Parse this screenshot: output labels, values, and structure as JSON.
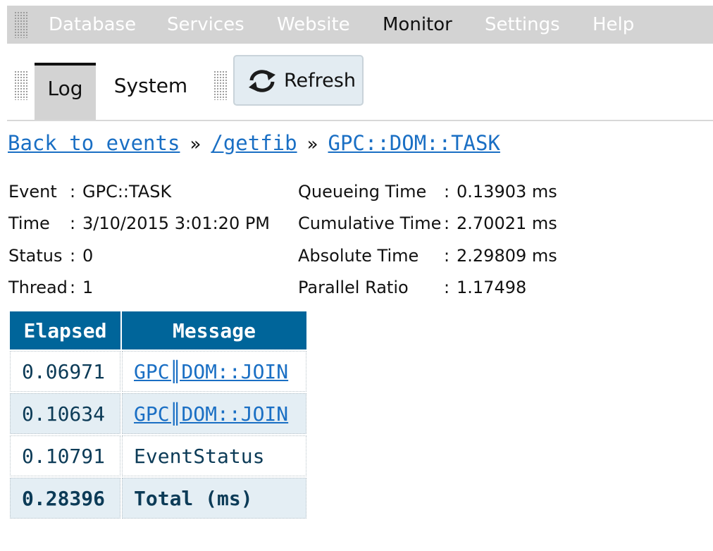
{
  "menu": {
    "items": [
      {
        "label": "Database",
        "active": false
      },
      {
        "label": "Services",
        "active": false
      },
      {
        "label": "Website",
        "active": false
      },
      {
        "label": "Monitor",
        "active": true
      },
      {
        "label": "Settings",
        "active": false
      },
      {
        "label": "Help",
        "active": false
      }
    ]
  },
  "toolbar": {
    "tabs": [
      {
        "label": "Log",
        "active": true
      },
      {
        "label": "System",
        "active": false
      }
    ],
    "refresh_label": "Refresh",
    "refresh_icon": "refresh-icon"
  },
  "breadcrumb": {
    "back": "Back to events",
    "separator": "»",
    "path": "/getfib",
    "current": "GPC::DOM::TASK"
  },
  "details": {
    "left": [
      {
        "key": "Event",
        "value": "GPC::TASK"
      },
      {
        "key": "Time",
        "value": "3/10/2015 3:01:20 PM"
      },
      {
        "key": "Status",
        "value": "0"
      },
      {
        "key": "Thread",
        "value": "1"
      }
    ],
    "right": [
      {
        "key": "Queueing Time",
        "value": "0.13903 ms"
      },
      {
        "key": "Cumulative Time",
        "value": "2.70021 ms"
      },
      {
        "key": "Absolute Time",
        "value": "2.29809 ms"
      },
      {
        "key": "Parallel Ratio",
        "value": "1.17498"
      }
    ],
    "colon": ":"
  },
  "table": {
    "headers": [
      "Elapsed",
      "Message"
    ],
    "rows": [
      {
        "elapsed": "0.06971",
        "message": "GPC║DOM::JOIN",
        "link": true
      },
      {
        "elapsed": "0.10634",
        "message": "GPC║DOM::JOIN",
        "link": true
      },
      {
        "elapsed": "0.10791",
        "message": "EventStatus",
        "link": false
      }
    ],
    "total": {
      "elapsed": "0.28396",
      "message": "Total (ms)"
    }
  },
  "colors": {
    "menubar_bg": "#d3d3d3",
    "header_bg": "#00659a",
    "link": "#1a6fc4",
    "row_alt": "#e4eef4"
  }
}
